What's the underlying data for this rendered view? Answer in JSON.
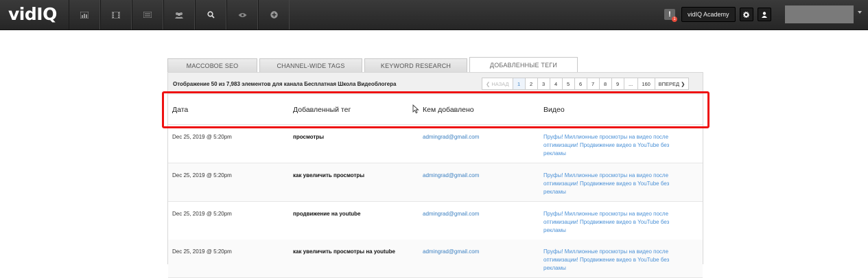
{
  "app": {
    "logo_main": "vid",
    "logo_accent": "IQ",
    "academy_label": "vidIQ Academy",
    "alert_count": "1",
    "nav_icons": [
      "chart-icon",
      "film-icon",
      "message-icon",
      "users-icon",
      "search-icon",
      "eye-icon",
      "plus-circle-icon"
    ]
  },
  "tabs": [
    {
      "label": "МАССОВОЕ SEO",
      "active": false
    },
    {
      "label": "CHANNEL-WIDE TAGS",
      "active": false
    },
    {
      "label": "KEYWORD RESEARCH",
      "active": false
    },
    {
      "label": "ДОБАВЛЕННЫЕ ТЕГИ",
      "active": true
    }
  ],
  "info": {
    "text": "Отображение 50 из 7,983 элементов для канала Бесплатная Школа Видеоблогера"
  },
  "pager": {
    "prev": "НАЗАД",
    "pages": [
      "1",
      "2",
      "3",
      "4",
      "5",
      "6",
      "7",
      "8",
      "9",
      "...",
      "160"
    ],
    "current": "1",
    "next": "ВПЕРЕД"
  },
  "table": {
    "headers": {
      "date": "Дата",
      "tag": "Добавленный тег",
      "who": "Кем добавлено",
      "video": "Видео"
    },
    "rows": [
      {
        "date": "Dec 25, 2019 @ 5:20pm",
        "tag": "просмотры",
        "who": "admingrad@gmail.com",
        "video": "Пруфы! Миллионные просмотры на видео после оптимизации! Продвижение видео в YouTube без рекламы"
      },
      {
        "date": "Dec 25, 2019 @ 5:20pm",
        "tag": "как увеличить просмотры",
        "who": "admingrad@gmail.com",
        "video": "Пруфы! Миллионные просмотры на видео после оптимизации! Продвижение видео в YouTube без рекламы"
      },
      {
        "date": "Dec 25, 2019 @ 5:20pm",
        "tag": "продвижение на youtube",
        "who": "admingrad@gmail.com",
        "video": "Пруфы! Миллионные просмотры на видео после оптимизации! Продвижение видео в YouTube без рекламы"
      },
      {
        "date": "Dec 25, 2019 @ 5:20pm",
        "tag": "как увеличить просмотры на youtube",
        "who": "admingrad@gmail.com",
        "video": "Пруфы! Миллионные просмотры на видео после оптимизации! Продвижение видео в YouTube без рекламы"
      }
    ]
  },
  "colors": {
    "topbar": "#2e2e2e",
    "link": "#3a7fc1",
    "highlight": "#ee1111"
  }
}
